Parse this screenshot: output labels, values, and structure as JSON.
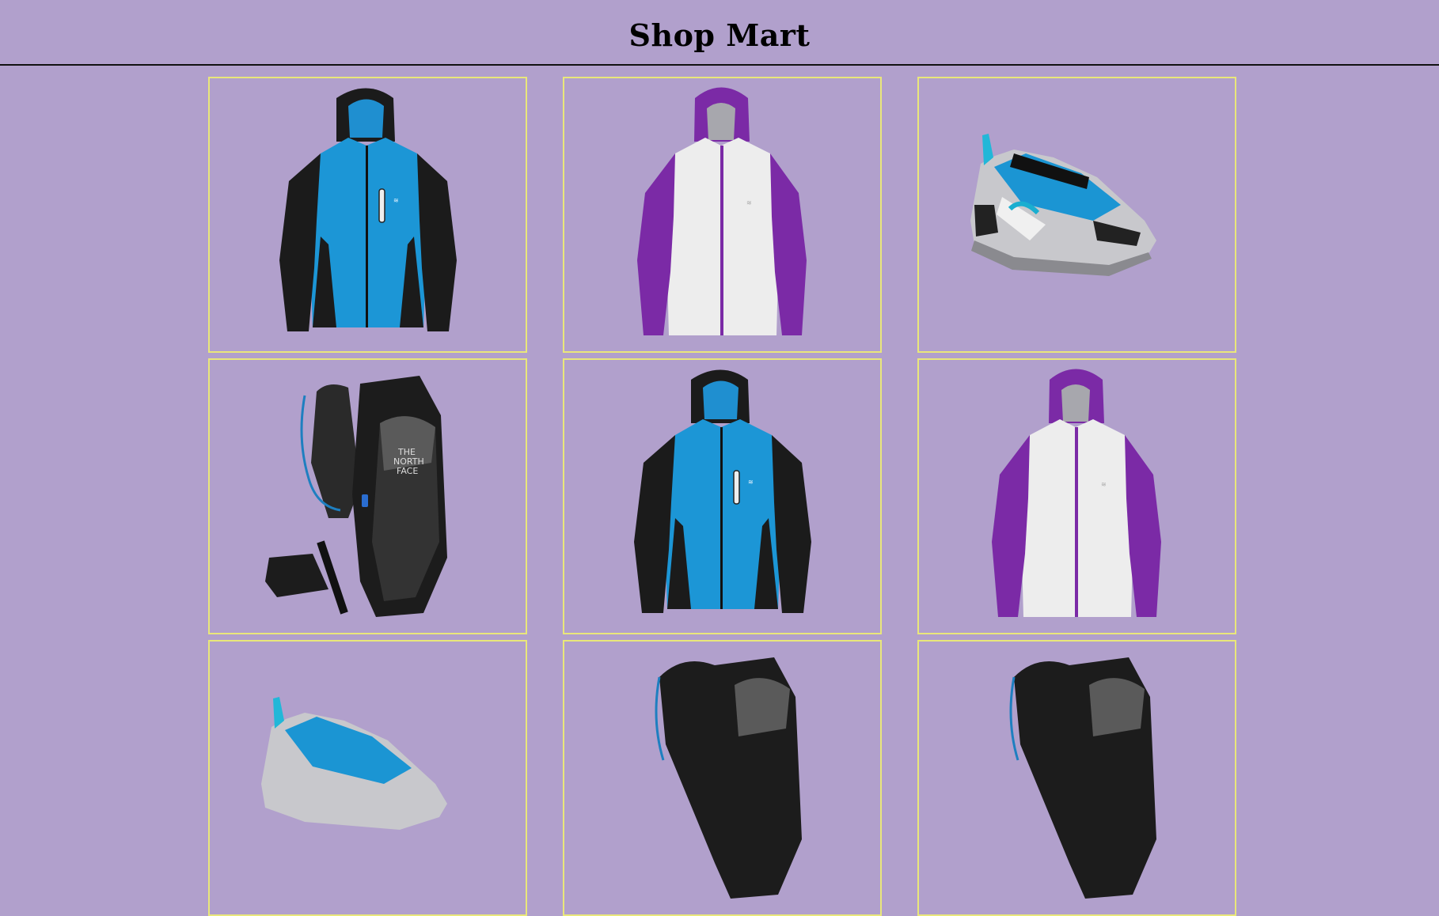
{
  "header": {
    "title": "Shop Mart"
  },
  "colors": {
    "background": "#b1a0cc",
    "card_border": "#e9e77a",
    "header_rule": "#111111"
  },
  "products": [
    {
      "image": "blue-black-hooded-jacket"
    },
    {
      "image": "white-purple-hooded-jacket"
    },
    {
      "image": "blue-gray-running-shoe"
    },
    {
      "image": "black-hydration-backpack"
    },
    {
      "image": "blue-black-hooded-jacket"
    },
    {
      "image": "white-purple-hooded-jacket"
    },
    {
      "image": "blue-gray-running-shoe"
    },
    {
      "image": "black-hydration-backpack"
    },
    {
      "image": "black-hydration-backpack"
    }
  ]
}
